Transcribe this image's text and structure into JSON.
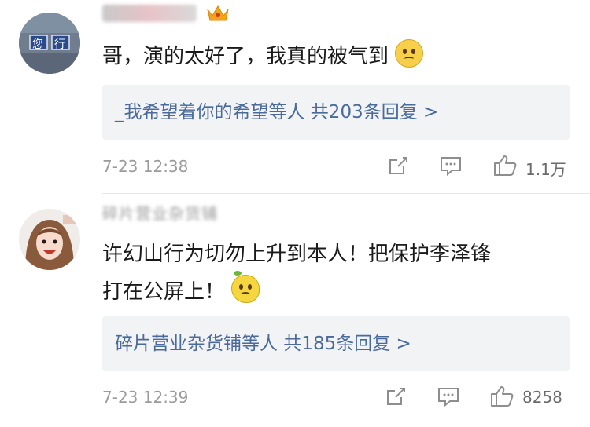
{
  "comments": [
    {
      "username": "",
      "crown_icon": "crown-icon",
      "text": "哥，演的太好了，我真的被气到",
      "emoji": "pleading-face",
      "replies": "_我希望着你的希望等人 共203条回复 >",
      "time": "7-23 12:38",
      "likes": "1.1万",
      "avatar_sign": [
        "您",
        "行"
      ]
    },
    {
      "username": "碎片营业杂货铺",
      "text_line1": "许幻山行为切勿上升到本人！把保护李泽锋",
      "text_line2": "打在公屏上！",
      "emoji": "lemon-face",
      "replies": "碎片营业杂货铺等人 共185条回复 >",
      "time": "7-23 12:39",
      "likes": "8258"
    }
  ],
  "colors": {
    "link": "#4a6a9a",
    "reply_bg": "#f2f3f5",
    "muted": "#9b9b9b",
    "crown": "#f3a417"
  }
}
